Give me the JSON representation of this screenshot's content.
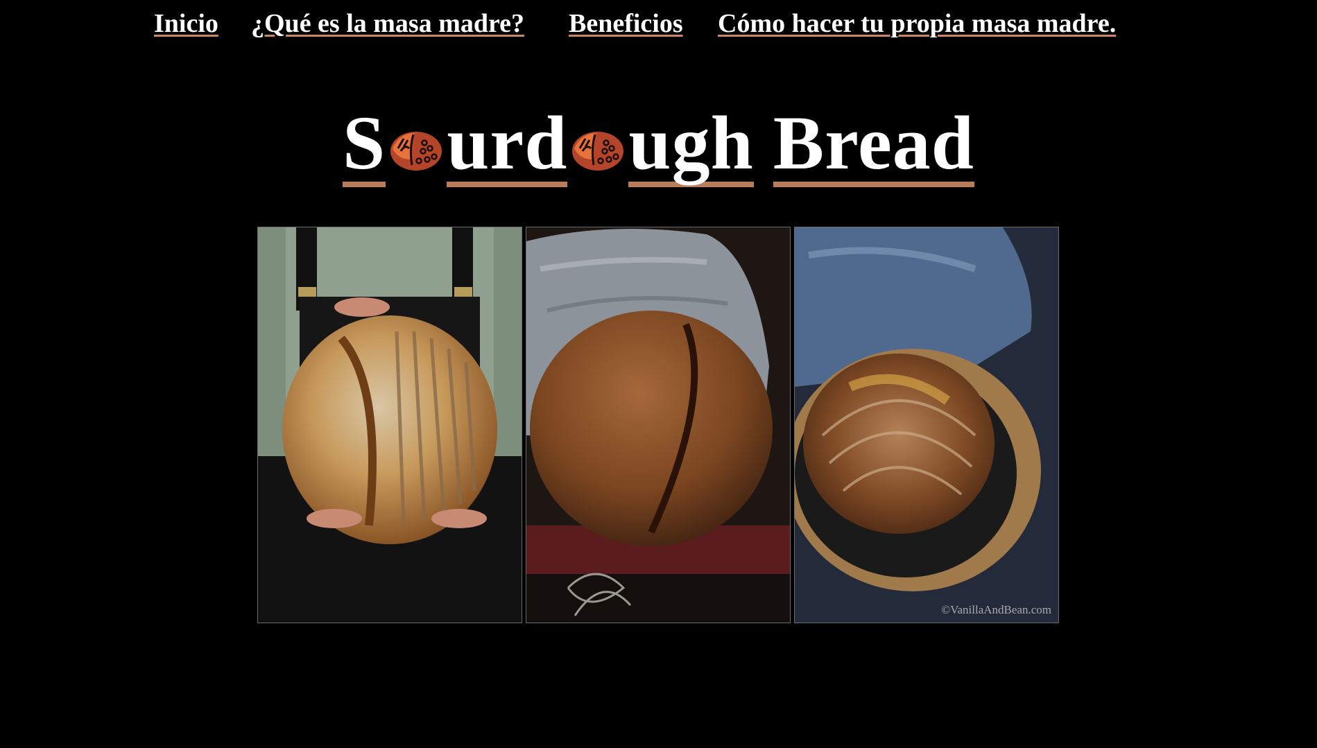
{
  "nav": {
    "items": [
      {
        "label": "Inicio"
      },
      {
        "label": "¿Qué es la masa madre?"
      },
      {
        "label": "Beneficios"
      },
      {
        "label": "Cómo hacer tu propia masa madre."
      }
    ]
  },
  "title": {
    "part1": "S",
    "part2": "urd",
    "part3": "ugh",
    "part4": "Bread"
  },
  "gallery": {
    "images": [
      {
        "name": "bread-held-in-hands"
      },
      {
        "name": "bread-on-cloth"
      },
      {
        "name": "bread-in-parchment-pan",
        "watermark": "©VanillaAndBean.com"
      }
    ]
  },
  "colors": {
    "background": "#000000",
    "text": "#ffffff",
    "underline_accent": "#c98660",
    "title_underline": "#b87d5a",
    "loaf_icon": "#b5452a"
  }
}
